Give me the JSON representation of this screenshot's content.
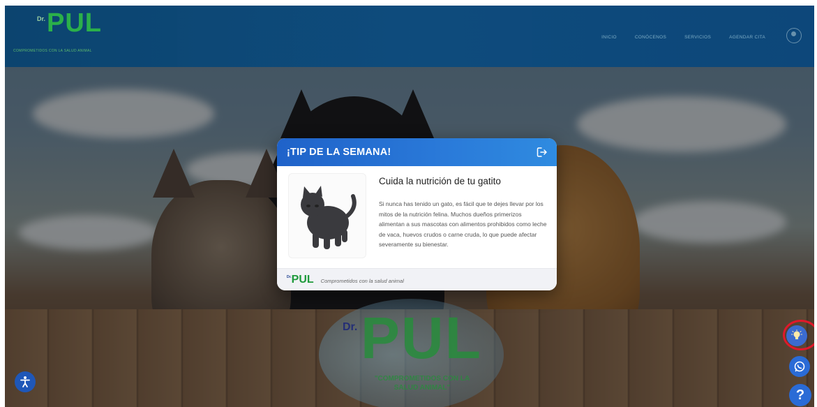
{
  "navbar": {
    "logo_prefix": "Dr.",
    "logo_text": "PUL",
    "tagline": "COMPROMETIDOS CON LA SALUD ANIMAL",
    "links": [
      "INICIO",
      "CONÓCENOS",
      "SERVICIOS",
      "AGENDAR CITA"
    ],
    "user_icon": "user-circle-icon"
  },
  "background_logo": {
    "prefix": "Dr.",
    "text": "PUL",
    "tagline": "\"COMPROMETIDOS CON LA SALUD ANIMAL\""
  },
  "modal": {
    "title": "¡TIP DE LA SEMANA!",
    "close_icon": "logout-icon",
    "image_icon": "black-cat-illustration",
    "heading": "Cuida la nutrición de tu gatito",
    "paragraph": "Si nunca has tenido un gato, es fácil que te dejes llevar por los mitos de la nutrición felina. Muchos dueños primerizos alimentan a sus mascotas con alimentos prohibidos como leche de vaca, huevos crudos o carne cruda, lo que puede afectar severamente su bienestar.",
    "footer_logo_prefix": "Dr.",
    "footer_logo_text": "PUL",
    "footer_slogan": "Comprometidos con la salud animal"
  },
  "floating": {
    "accessibility_icon": "accessibility-icon",
    "tip_icon": "lightbulb-icon",
    "whatsapp_icon": "whatsapp-icon",
    "help_label": "?"
  },
  "colors": {
    "navbar": "#0c4b7d",
    "brand_green": "#2bb34a",
    "modal_header": "#2a7ad9",
    "highlight_ring": "#e0192a"
  }
}
